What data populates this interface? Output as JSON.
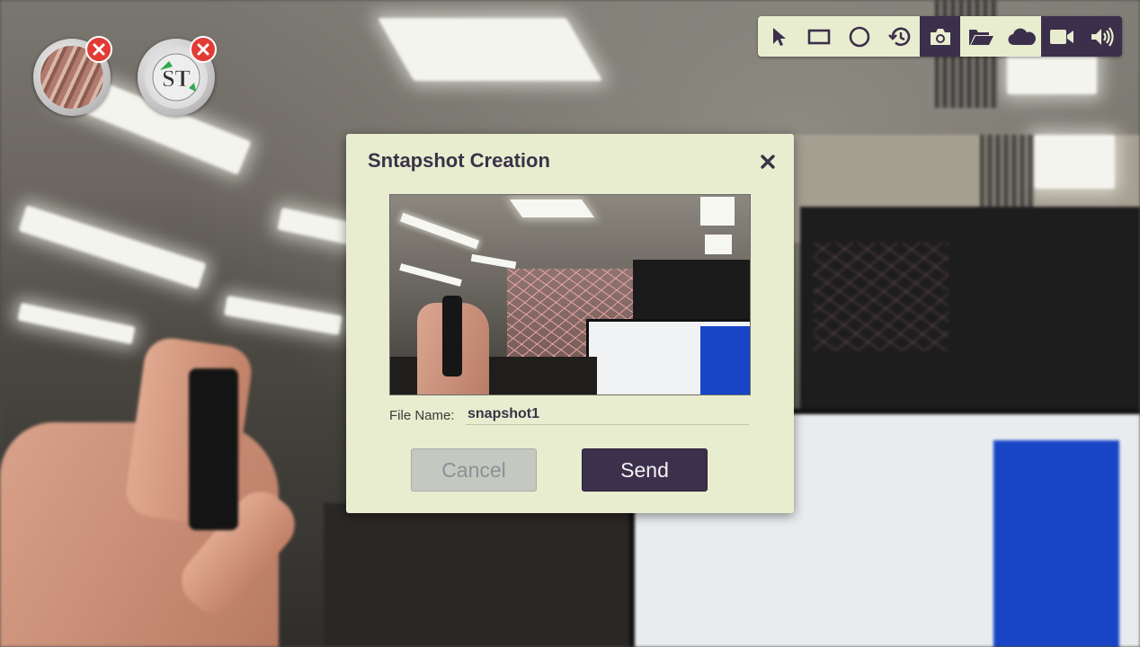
{
  "participants": [
    {
      "name": "participant-avatar-1",
      "remove_icon": "close-icon"
    },
    {
      "name": "participant-avatar-2",
      "logo_text": "ST",
      "remove_icon": "close-icon"
    }
  ],
  "toolbar": {
    "tools": [
      {
        "id": "pointer",
        "icon": "cursor-icon",
        "active": false
      },
      {
        "id": "rectangle",
        "icon": "rectangle-icon",
        "active": false
      },
      {
        "id": "circle",
        "icon": "circle-icon",
        "active": false
      },
      {
        "id": "history",
        "icon": "history-icon",
        "active": false
      },
      {
        "id": "snapshot",
        "icon": "camera-icon",
        "active": true
      },
      {
        "id": "open",
        "icon": "folder-open-icon",
        "active": false
      },
      {
        "id": "cloud",
        "icon": "cloud-icon",
        "active": false
      },
      {
        "id": "video",
        "icon": "video-camera-icon",
        "active": true
      },
      {
        "id": "audio",
        "icon": "speaker-icon",
        "active": true
      }
    ],
    "colors": {
      "light": "#e8edcf",
      "dark": "#3b2f4b"
    }
  },
  "dialog": {
    "title": "Sntapshot Creation",
    "close_icon": "close-icon",
    "file_name_label": "File Name:",
    "file_name_value": "snapshot1",
    "cancel_label": "Cancel",
    "send_label": "Send",
    "colors": {
      "background": "#e8edcf",
      "title": "#3a3348",
      "send": "#3c304d",
      "cancel": "#c5c8c0"
    }
  }
}
